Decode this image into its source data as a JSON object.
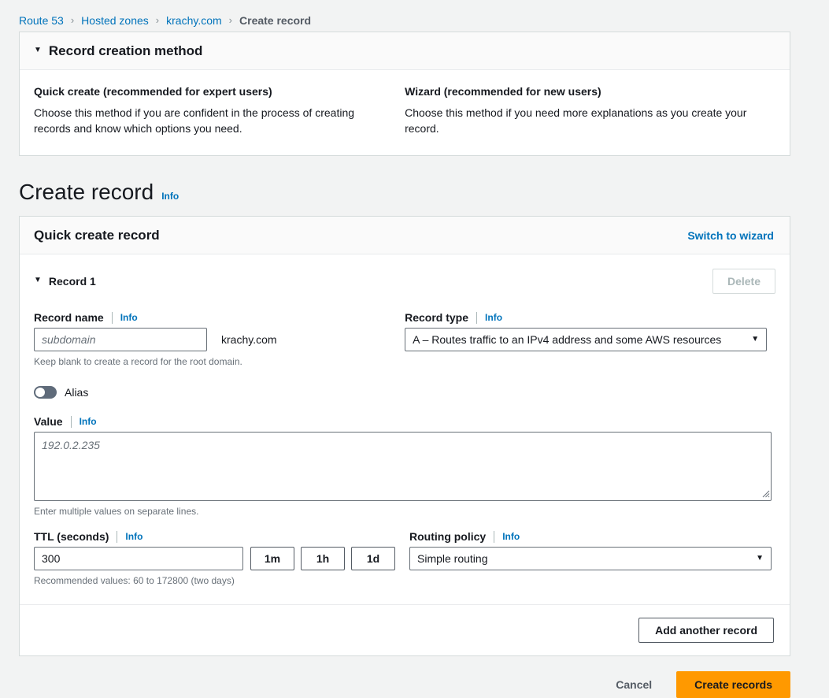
{
  "breadcrumb": {
    "items": [
      {
        "label": "Route 53",
        "current": false
      },
      {
        "label": "Hosted zones",
        "current": false
      },
      {
        "label": "krachy.com",
        "current": false
      },
      {
        "label": "Create record",
        "current": true
      }
    ],
    "separator": "›"
  },
  "creation_method": {
    "panel_title": "Record creation method",
    "twisty": "▼",
    "options": [
      {
        "title": "Quick create (recommended for expert users)",
        "description": "Choose this method if you are confident in the process of creating records and know which options you need."
      },
      {
        "title": "Wizard (recommended for new users)",
        "description": "Choose this method if you need more explanations as you create your record."
      }
    ]
  },
  "page": {
    "title": "Create record",
    "info_label": "Info"
  },
  "quick_create": {
    "panel_title": "Quick create record",
    "switch_link": "Switch to wizard",
    "record_label": "Record 1",
    "twisty": "▼",
    "delete_label": "Delete",
    "delete_disabled": true,
    "record_name": {
      "label": "Record name",
      "info_label": "Info",
      "value": "",
      "placeholder": "subdomain",
      "suffix": "krachy.com",
      "helper": "Keep blank to create a record for the root domain."
    },
    "record_type": {
      "label": "Record type",
      "info_label": "Info",
      "selected": "A – Routes traffic to an IPv4 address and some AWS resources",
      "caret": "▼"
    },
    "alias": {
      "label": "Alias",
      "enabled": false
    },
    "value": {
      "label": "Value",
      "info_label": "Info",
      "value": "",
      "placeholder": "192.0.2.235",
      "helper": "Enter multiple values on separate lines."
    },
    "ttl": {
      "label": "TTL (seconds)",
      "info_label": "Info",
      "value": "300",
      "helper": "Recommended values: 60 to 172800 (two days)",
      "presets": [
        "1m",
        "1h",
        "1d"
      ]
    },
    "routing_policy": {
      "label": "Routing policy",
      "info_label": "Info",
      "selected": "Simple routing",
      "caret": "▼"
    },
    "add_another_label": "Add another record"
  },
  "actions": {
    "cancel_label": "Cancel",
    "create_label": "Create records"
  },
  "colors": {
    "page_background": "#f2f3f3",
    "card_background": "#ffffff",
    "link_blue": "#0073bb",
    "primary_orange": "#ff9900",
    "border_gray": "#d5dbdb",
    "toggle_off": "#5f6b7a"
  }
}
